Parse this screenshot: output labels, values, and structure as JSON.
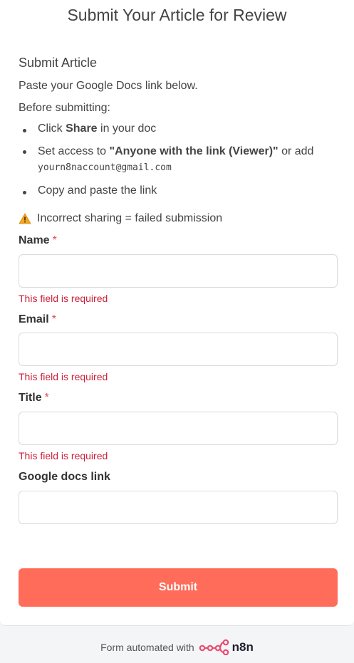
{
  "page": {
    "title": "Submit Your Article for Review"
  },
  "intro": {
    "section_title": "Submit Article",
    "line1": "Paste your Google Docs link below.",
    "line2": "Before submitting:",
    "bullets": {
      "b1_prefix": "Click ",
      "b1_bold": "Share",
      "b1_suffix": " in your doc",
      "b2_prefix": "Set access to ",
      "b2_bold": "\"Anyone with the link (Viewer)\"",
      "b2_suffix": " or add",
      "b2_email": "yourn8naccount@gmail.com",
      "b3": "Copy and paste the link"
    },
    "warning": "Incorrect sharing = failed submission",
    "warning_icon": "warning-icon"
  },
  "form": {
    "name": {
      "label": "Name",
      "required_mark": "*",
      "value": "",
      "error": "This field is required"
    },
    "email": {
      "label": "Email",
      "required_mark": "*",
      "value": "",
      "error": "This field is required"
    },
    "title": {
      "label": "Title",
      "required_mark": "*",
      "value": "",
      "error": "This field is required"
    },
    "docs_link": {
      "label": "Google docs link",
      "value": ""
    },
    "submit_label": "Submit"
  },
  "footer": {
    "text": "Form automated with",
    "brand": "n8n",
    "brand_icon": "n8n-logo-icon"
  },
  "colors": {
    "accent": "#ff6d5a",
    "error": "#cc1f3a",
    "required": "#e5484d"
  }
}
